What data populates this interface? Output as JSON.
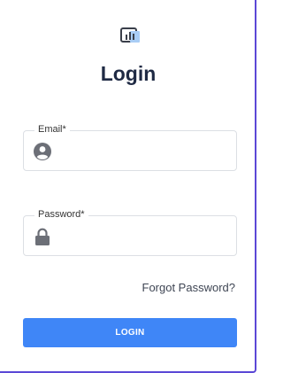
{
  "header": {
    "logo_icon": "chart-logo-icon",
    "title": "Login"
  },
  "form": {
    "email": {
      "label": "Email*",
      "value": "",
      "icon": "user-circle-icon"
    },
    "password": {
      "label": "Password*",
      "value": "",
      "icon": "lock-icon"
    },
    "forgot_label": "Forgot Password?",
    "login_label": "LOGIN"
  },
  "colors": {
    "accent": "#3f86f7",
    "title": "#1f2a44",
    "icon": "#6c6f77",
    "border": "#dcdfe4"
  }
}
